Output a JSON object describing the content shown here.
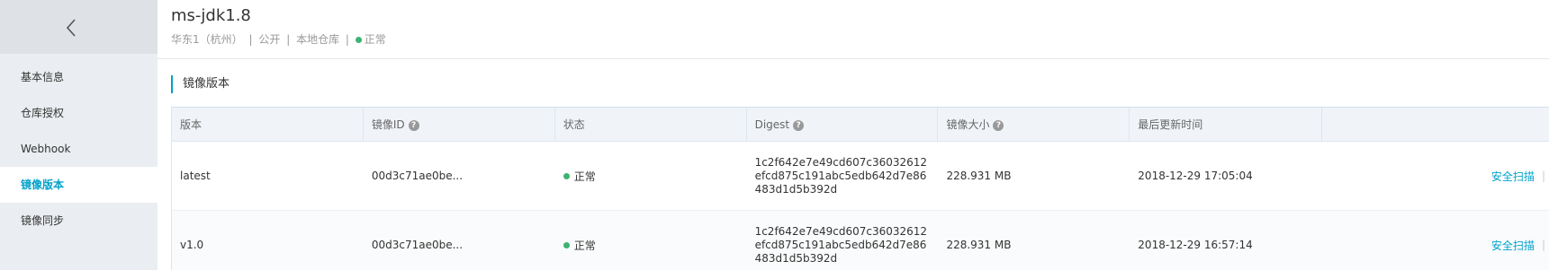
{
  "sidebar": {
    "back_icon": "chevron-left-icon",
    "items": [
      {
        "label": "基本信息"
      },
      {
        "label": "仓库授权"
      },
      {
        "label": "Webhook"
      },
      {
        "label": "镜像版本",
        "active": true
      },
      {
        "label": "镜像同步"
      }
    ]
  },
  "header": {
    "title": "ms-jdk1.8",
    "region": "华东1（杭州）",
    "visibility": "公开",
    "repo_type": "本地仓库",
    "status": "正常",
    "separator": "|"
  },
  "section": {
    "title": "镜像版本"
  },
  "table": {
    "columns": [
      {
        "label": "版本",
        "help": false
      },
      {
        "label": "镜像ID",
        "help": true
      },
      {
        "label": "状态",
        "help": false
      },
      {
        "label": "Digest",
        "help": true
      },
      {
        "label": "镜像大小",
        "help": true
      },
      {
        "label": "最后更新时间",
        "help": false
      },
      {
        "label": "",
        "help": false
      }
    ],
    "help_glyph": "?",
    "rows": [
      {
        "version": "latest",
        "image_id": "00d3c71ae0be...",
        "status": "正常",
        "digest": "1c2f642e7e49cd607c36032612efcd875c191abc5edb642d7e86483d1d5b392d",
        "size": "228.931 MB",
        "updated": "2018-12-29 17:05:04",
        "action": "安全扫描",
        "action_sep": "|"
      },
      {
        "version": "v1.0",
        "image_id": "00d3c71ae0be...",
        "status": "正常",
        "digest": "1c2f642e7e49cd607c36032612efcd875c191abc5edb642d7e86483d1d5b392d",
        "size": "228.931 MB",
        "updated": "2018-12-29 16:57:14",
        "action": "安全扫描",
        "action_sep": "|"
      }
    ]
  },
  "colors": {
    "accent": "#00a2ca",
    "status_ok": "#3cb371",
    "sidebar_bg": "#eaedf1",
    "table_header_bg": "#f0f4f9"
  }
}
